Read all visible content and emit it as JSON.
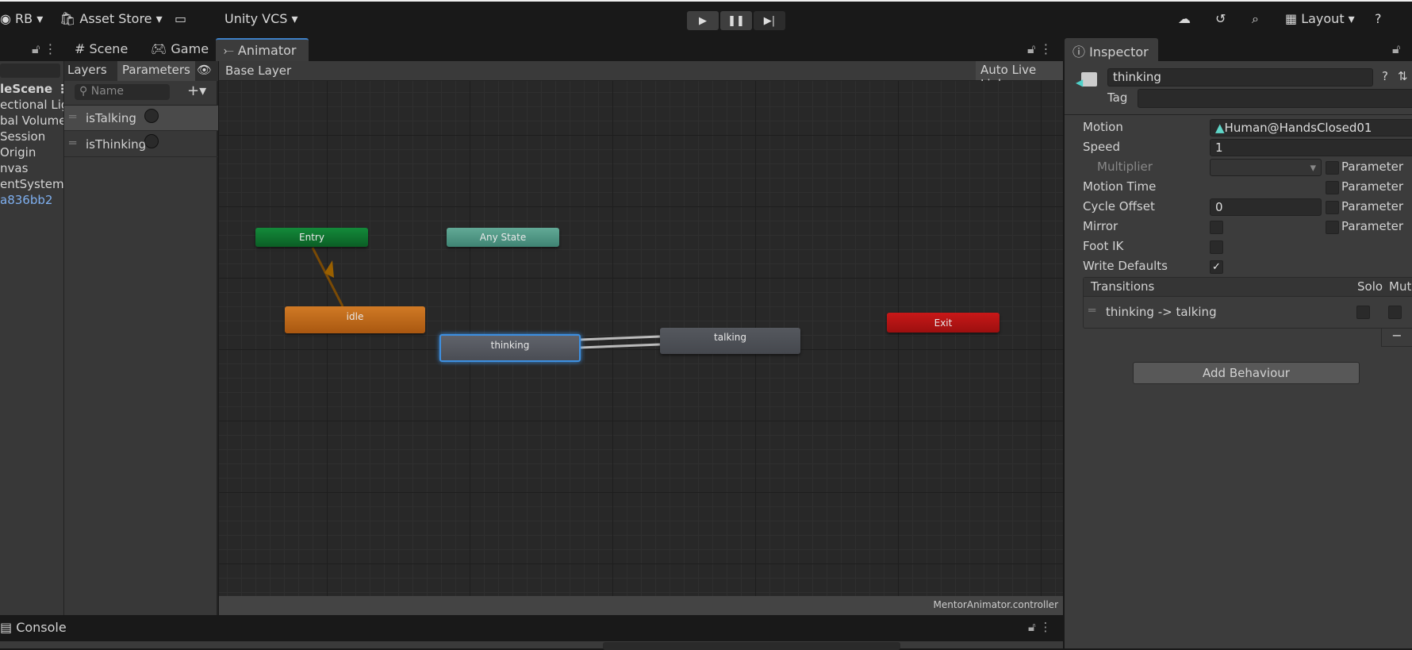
{
  "toolbar": {
    "account": "RB",
    "asset_store": "Asset Store",
    "vcs": "Unity VCS",
    "layout": "Layout"
  },
  "tabs": [
    {
      "label": "Scene"
    },
    {
      "label": "Game"
    },
    {
      "label": "Animator"
    }
  ],
  "hierarchy": {
    "scene": "leScene",
    "items": [
      "ectional Ligl",
      "bal Volume",
      "Session",
      "Origin",
      "nvas",
      "entSystem",
      "a836bb2"
    ]
  },
  "animator": {
    "layers_tab": "Layers",
    "parameters_tab": "Parameters",
    "search_placeholder": "Name",
    "params": [
      {
        "name": "isTalking"
      },
      {
        "name": "isThinking"
      }
    ],
    "breadcrumb": "Base Layer",
    "auto_live_link": "Auto Live Link",
    "controller": "MentorAnimator.controller",
    "states": {
      "entry": "Entry",
      "any": "Any State",
      "idle": "idle",
      "thinking": "thinking",
      "talking": "talking",
      "exit": "Exit"
    },
    "colors": {
      "entry": "#0d6e2c",
      "any": "#4a9584",
      "idle": "#c26a1c",
      "exit": "#b31414",
      "default": "#54575e",
      "selected_outline": "#3d8fe0"
    }
  },
  "console": {
    "title": "Console"
  },
  "inspector": {
    "title": "Inspector",
    "name": "thinking",
    "tag_label": "Tag",
    "tag_value": "",
    "motion_label": "Motion",
    "motion_value": "Human@HandsClosed01",
    "speed_label": "Speed",
    "speed_value": "1",
    "multiplier_label": "Multiplier",
    "motion_time_label": "Motion Time",
    "cycle_offset_label": "Cycle Offset",
    "cycle_offset_value": "0",
    "mirror_label": "Mirror",
    "foot_ik_label": "Foot IK",
    "write_defaults_label": "Write Defaults",
    "write_defaults": true,
    "parameter_label": "Parameter",
    "transitions_header": "Transitions",
    "solo": "Solo",
    "mute": "Mute",
    "transitions": [
      "thinking -> talking"
    ],
    "add_behaviour": "Add Behaviour"
  }
}
